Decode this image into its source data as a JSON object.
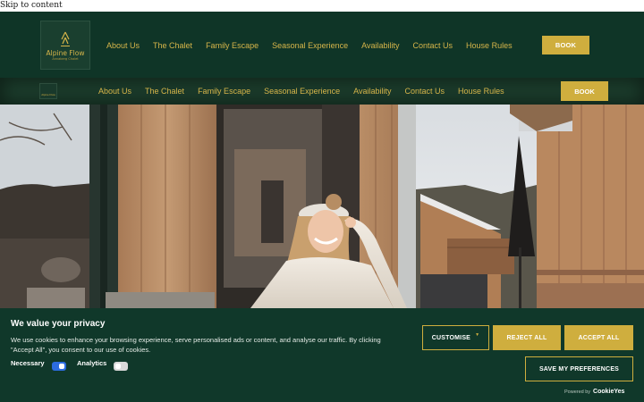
{
  "skip_link": "Skip to content",
  "brand": {
    "name": "Alpine Flow",
    "tagline": "Annaberg Chalet"
  },
  "nav": [
    "About Us",
    "The Chalet",
    "Family Escape",
    "Seasonal Experience",
    "Availability",
    "Contact Us",
    "House Rules"
  ],
  "book_label": "BOOK",
  "sticky_nav": [
    "About Us",
    "The Chalet",
    "Family Escape",
    "Seasonal Experience",
    "Availability",
    "Contact Us",
    "House Rules"
  ],
  "sticky_book_label": "BOOK",
  "cookie": {
    "title": "We value your privacy",
    "text": "We use cookies to enhance your browsing experience, serve personalised ads or content, and analyse our traffic. By clicking \"Accept All\", you consent to our use of cookies.",
    "toggles": [
      {
        "label": "Necessary",
        "on": true
      },
      {
        "label": "Analytics",
        "on": false
      }
    ],
    "customise_label": "CUSTOMISE",
    "reject_label": "REJECT ALL",
    "accept_label": "ACCEPT ALL",
    "save_label": "SAVE MY PREFERENCES",
    "powered_prefix": "Powered by",
    "powered_brand": "CookieYes"
  },
  "colors": {
    "brand_green": "#0f3527",
    "gold": "#cfae3e",
    "toggle_on": "#2c6ce0"
  },
  "icons": [
    "skip-link",
    "logo-mountain-icon",
    "dropdown-caret-icon"
  ]
}
